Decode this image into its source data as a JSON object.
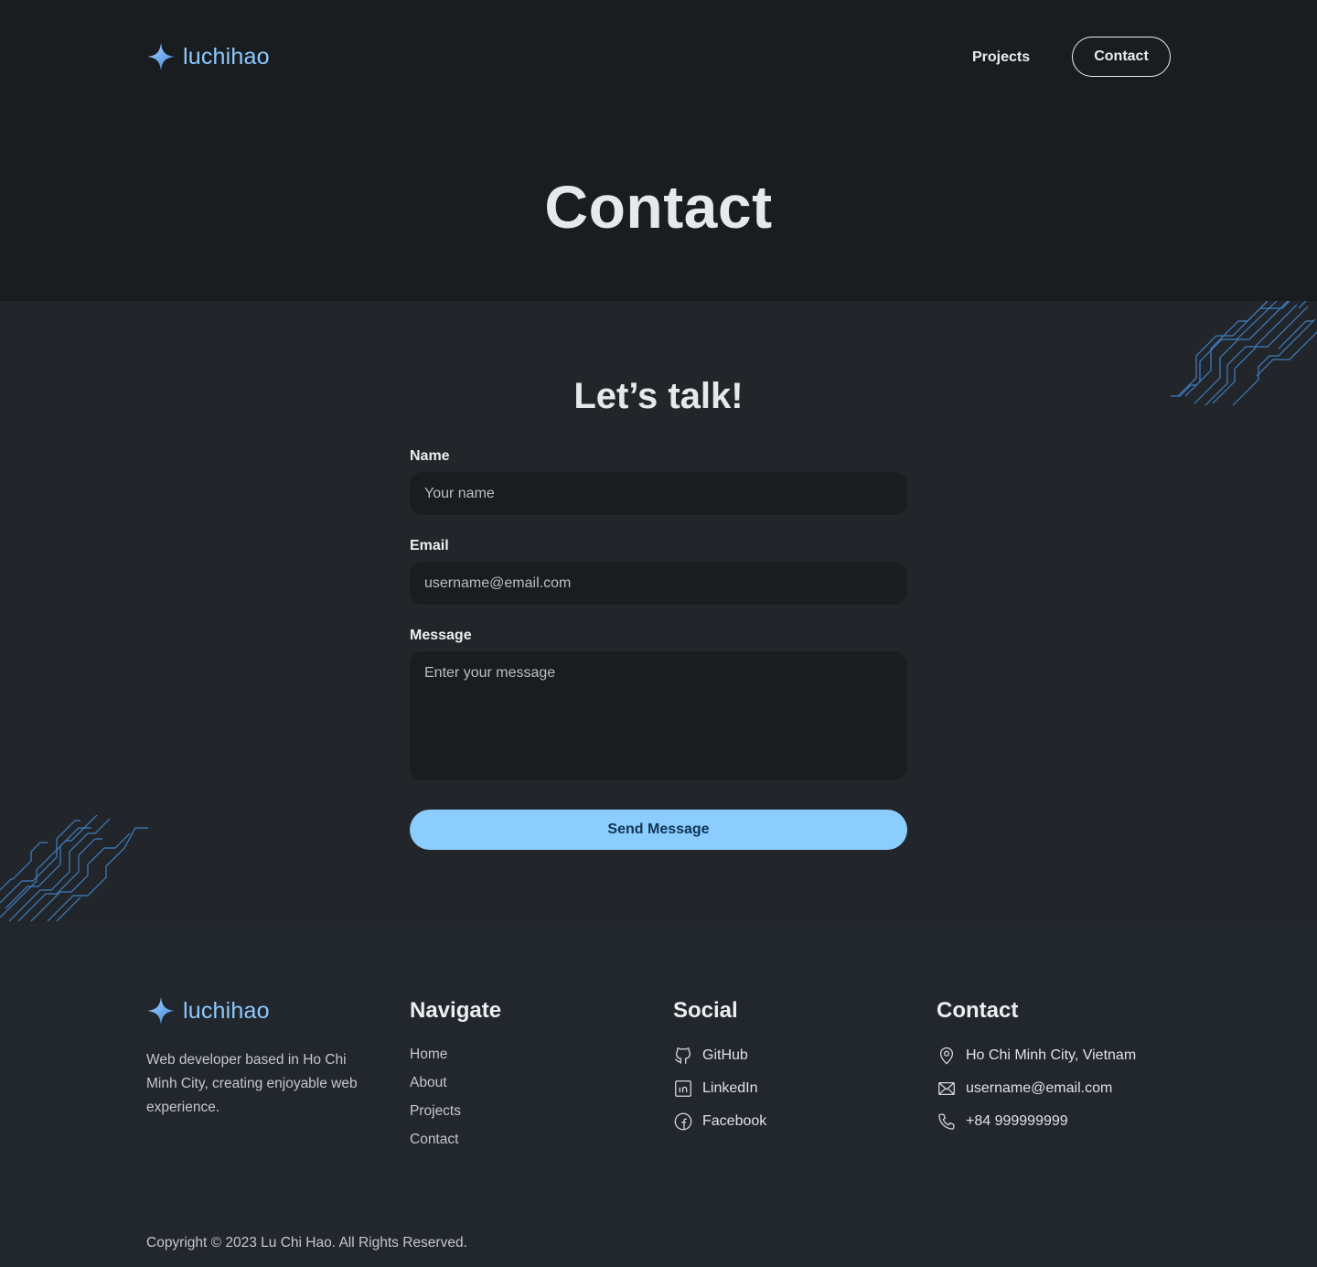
{
  "brand": {
    "name": "luchihao",
    "icon": "sparkle-star-icon",
    "accent_color": "#8ccaff"
  },
  "nav": {
    "projects_label": "Projects",
    "contact_label": "Contact"
  },
  "hero": {
    "title": "Contact"
  },
  "form": {
    "title": "Let’s talk!",
    "name": {
      "label": "Name",
      "placeholder": "Your name",
      "value": ""
    },
    "email": {
      "label": "Email",
      "placeholder": "username@email.com",
      "value": ""
    },
    "message": {
      "label": "Message",
      "placeholder": "Enter your message",
      "value": ""
    },
    "submit_label": "Send Message",
    "submit_color": "#8ccdff"
  },
  "footer": {
    "about": "Web developer based in Ho Chi Minh City, creating enjoyable web experience.",
    "navigate": {
      "title": "Navigate",
      "links": [
        "Home",
        "About",
        "Projects",
        "Contact"
      ]
    },
    "social": {
      "title": "Social",
      "items": [
        {
          "label": "GitHub",
          "icon": "github-icon"
        },
        {
          "label": "LinkedIn",
          "icon": "linkedin-icon"
        },
        {
          "label": "Facebook",
          "icon": "facebook-icon"
        }
      ]
    },
    "contact": {
      "title": "Contact",
      "items": [
        {
          "label": "Ho Chi Minh City, Vietnam",
          "icon": "location-pin-icon"
        },
        {
          "label": "username@email.com",
          "icon": "mail-icon"
        },
        {
          "label": "+84 999999999",
          "icon": "phone-icon"
        }
      ]
    },
    "copyright": "Copyright © 2023 Lu Chi Hao. All Rights Reserved."
  },
  "colors": {
    "hero_bg": "#1a1d20",
    "main_bg": "#22262a",
    "footer_bg": "#22272d",
    "circuit": "#3f7fc4"
  }
}
